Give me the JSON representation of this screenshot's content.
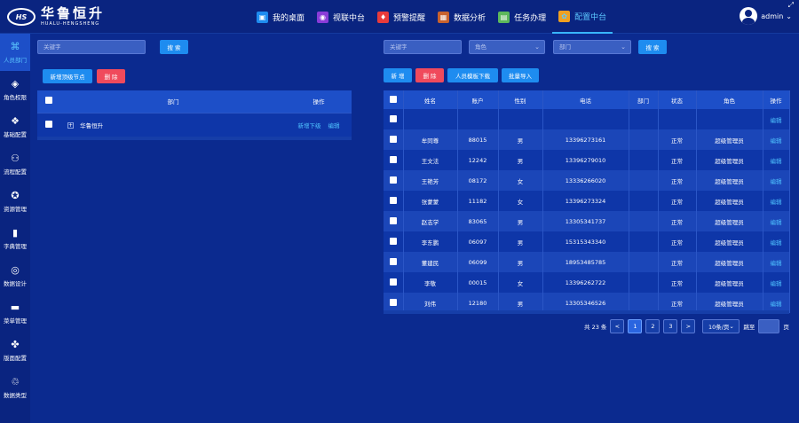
{
  "app": {
    "logo_cn": "华鲁恒升",
    "logo_en": "HUALU-HENGSHENG",
    "logo_mark": "HS",
    "user": "admin"
  },
  "nav": [
    {
      "label": "我的桌面",
      "icon": "desktop-icon",
      "glyph": "▣",
      "color": "#1e8cf0"
    },
    {
      "label": "视联中台",
      "icon": "video-icon",
      "glyph": "◉",
      "color": "#8a3cd8"
    },
    {
      "label": "预警提醒",
      "icon": "alarm-icon",
      "glyph": "♦",
      "color": "#e83b3b"
    },
    {
      "label": "数据分析",
      "icon": "analysis-icon",
      "glyph": "▦",
      "color": "#c8622e"
    },
    {
      "label": "任务办理",
      "icon": "task-icon",
      "glyph": "▤",
      "color": "#5cb85c"
    },
    {
      "label": "配置中台",
      "icon": "config-icon",
      "glyph": "✿",
      "color": "#f0a020"
    }
  ],
  "sidebar": [
    {
      "label": "人员部门",
      "icon": "people-dept-icon",
      "glyph": "⌘"
    },
    {
      "label": "角色权限",
      "icon": "role-icon",
      "glyph": "◈"
    },
    {
      "label": "基础配置",
      "icon": "base-config-icon",
      "glyph": "❖"
    },
    {
      "label": "流程配置",
      "icon": "flow-icon",
      "glyph": "⚇"
    },
    {
      "label": "资源管理",
      "icon": "resource-icon",
      "glyph": "✪"
    },
    {
      "label": "字典管理",
      "icon": "dictionary-icon",
      "glyph": "▮"
    },
    {
      "label": "数据设计",
      "icon": "data-design-icon",
      "glyph": "◎"
    },
    {
      "label": "菜单管理",
      "icon": "menu-icon",
      "glyph": "▬"
    },
    {
      "label": "版面配置",
      "icon": "layout-icon",
      "glyph": "✤"
    },
    {
      "label": "数据类型",
      "icon": "data-type-icon",
      "glyph": "♲"
    }
  ],
  "left": {
    "keyword_placeholder": "关键字",
    "search_label": "搜 索",
    "add_top_node_label": "新增顶级节点",
    "delete_label": "删 除",
    "headers": {
      "dept": "部门",
      "ops": "操作"
    },
    "rows": [
      {
        "name": "华鲁恒升",
        "add": "新增下级",
        "edit": "编辑"
      }
    ]
  },
  "right": {
    "keyword_placeholder": "关键字",
    "role_select": "角色",
    "dept_select": "部门",
    "search_label": "搜 索",
    "add_label": "新 增",
    "delete_label": "删 除",
    "template_label": "人员模板下载",
    "import_label": "批量导入",
    "headers": [
      "姓名",
      "账户",
      "性别",
      "电话",
      "部门",
      "状态",
      "角色",
      "操作"
    ],
    "rows": [
      {
        "name": "",
        "account": "",
        "gender": "",
        "phone": "",
        "dept": "",
        "status": "",
        "role": "",
        "op": "编辑"
      },
      {
        "name": "牟同尊",
        "account": "88015",
        "gender": "男",
        "phone": "13396273161",
        "dept": "",
        "status": "正常",
        "role": "超级管理员",
        "op": "编辑"
      },
      {
        "name": "王文法",
        "account": "12242",
        "gender": "男",
        "phone": "13396279010",
        "dept": "",
        "status": "正常",
        "role": "超级管理员",
        "op": "编辑"
      },
      {
        "name": "王艳芳",
        "account": "08172",
        "gender": "女",
        "phone": "13336266020",
        "dept": "",
        "status": "正常",
        "role": "超级管理员",
        "op": "编辑"
      },
      {
        "name": "张蒙蒙",
        "account": "11182",
        "gender": "女",
        "phone": "13396273324",
        "dept": "",
        "status": "正常",
        "role": "超级管理员",
        "op": "编辑"
      },
      {
        "name": "赵志学",
        "account": "83065",
        "gender": "男",
        "phone": "13305341737",
        "dept": "",
        "status": "正常",
        "role": "超级管理员",
        "op": "编辑"
      },
      {
        "name": "李东鹏",
        "account": "06097",
        "gender": "男",
        "phone": "15315343340",
        "dept": "",
        "status": "正常",
        "role": "超级管理员",
        "op": "编辑"
      },
      {
        "name": "董建民",
        "account": "06099",
        "gender": "男",
        "phone": "18953485785",
        "dept": "",
        "status": "正常",
        "role": "超级管理员",
        "op": "编辑"
      },
      {
        "name": "李敬",
        "account": "00015",
        "gender": "女",
        "phone": "13396262722",
        "dept": "",
        "status": "正常",
        "role": "超级管理员",
        "op": "编辑"
      },
      {
        "name": "刘伟",
        "account": "12180",
        "gender": "男",
        "phone": "13305346526",
        "dept": "",
        "status": "正常",
        "role": "超级管理员",
        "op": "编辑"
      }
    ],
    "pagination": {
      "total": "共 23 条",
      "pages": [
        "1",
        "2",
        "3"
      ],
      "prev": "<",
      "next": ">",
      "page_size": "10条/页",
      "jump_label": "跳至",
      "page_unit": "页"
    }
  }
}
